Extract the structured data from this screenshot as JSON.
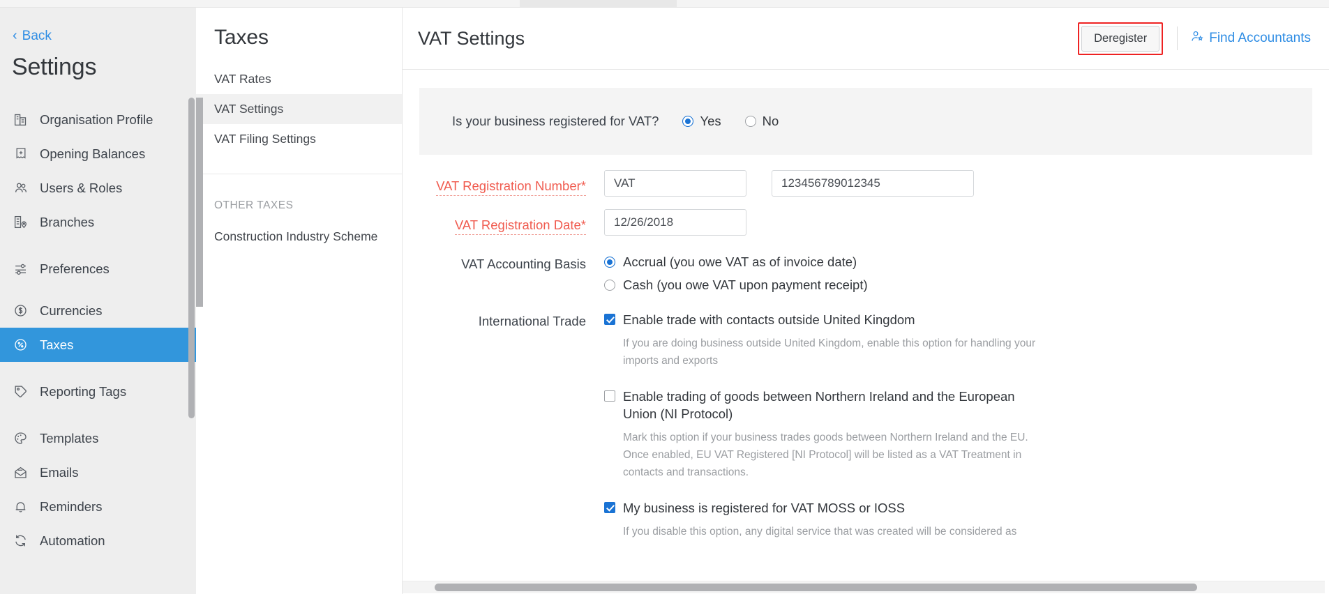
{
  "sidebar": {
    "back_label": "Back",
    "title": "Settings",
    "items": [
      {
        "label": "Organisation Profile",
        "icon": "building-icon",
        "active": false
      },
      {
        "label": "Opening Balances",
        "icon": "receipt-plus-icon",
        "active": false
      },
      {
        "label": "Users & Roles",
        "icon": "users-icon",
        "active": false
      },
      {
        "label": "Branches",
        "icon": "branch-pin-icon",
        "active": false
      },
      {
        "label": "Preferences",
        "icon": "sliders-icon",
        "active": false
      },
      {
        "label": "Currencies",
        "icon": "dollar-circle-icon",
        "active": false
      },
      {
        "label": "Taxes",
        "icon": "percent-circle-icon",
        "active": true
      },
      {
        "label": "Reporting Tags",
        "icon": "tag-icon",
        "active": false
      },
      {
        "label": "Templates",
        "icon": "palette-icon",
        "active": false
      },
      {
        "label": "Emails",
        "icon": "envelope-icon",
        "active": false
      },
      {
        "label": "Reminders",
        "icon": "bell-icon",
        "active": false
      },
      {
        "label": "Automation",
        "icon": "refresh-icon",
        "active": false
      }
    ]
  },
  "taxes_panel": {
    "title": "Taxes",
    "items": [
      {
        "label": "VAT Rates",
        "active": false
      },
      {
        "label": "VAT Settings",
        "active": true
      },
      {
        "label": "VAT Filing Settings",
        "active": false
      }
    ],
    "group_label": "OTHER TAXES",
    "group_items": [
      {
        "label": "Construction Industry Scheme",
        "active": false
      }
    ]
  },
  "main": {
    "title": "VAT Settings",
    "deregister_label": "Deregister",
    "find_accountants_label": "Find Accountants",
    "registration_question": {
      "label": "Is your business registered for VAT?",
      "options": [
        {
          "label": "Yes",
          "selected": true
        },
        {
          "label": "No",
          "selected": false
        }
      ]
    },
    "fields": {
      "vat_registration_number": {
        "label": "VAT Registration Number*",
        "prefix_value": "VAT",
        "number_value": "123456789012345"
      },
      "vat_registration_date": {
        "label": "VAT Registration Date*",
        "value": "12/26/2018"
      },
      "vat_accounting_basis": {
        "label": "VAT Accounting Basis",
        "options": [
          {
            "label": "Accrual (you owe VAT as of invoice date)",
            "selected": true
          },
          {
            "label": "Cash (you owe VAT upon payment receipt)",
            "selected": false
          }
        ]
      },
      "international_trade": {
        "label": "International Trade",
        "checkboxes": [
          {
            "label": "Enable trade with contacts outside United Kingdom",
            "checked": true,
            "help": "If you are doing business outside United Kingdom, enable this option for handling your imports and exports"
          },
          {
            "label": "Enable trading of goods between Northern Ireland and the European Union (NI Protocol)",
            "checked": false,
            "help": "Mark this option if your business trades goods between Northern Ireland and the EU. Once enabled, EU VAT Registered [NI Protocol] will be listed as a VAT Treatment in contacts and transactions."
          },
          {
            "label": "My business is registered for VAT MOSS or IOSS",
            "checked": true,
            "help": "If you disable this option, any digital service that was created will be considered as"
          }
        ]
      }
    }
  },
  "colors": {
    "accent_blue": "#3296dc",
    "link_blue": "#2f8de4",
    "required_red": "#f05b4f",
    "highlight_red": "#ee2222",
    "checkbox_blue": "#1a73d4"
  }
}
